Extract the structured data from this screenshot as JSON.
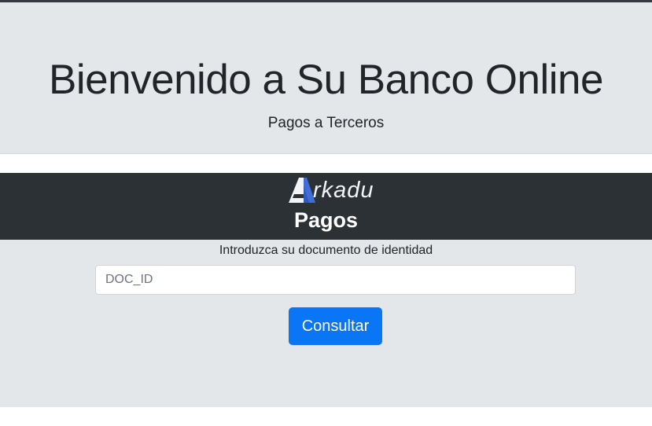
{
  "header": {
    "title": "Bienvenido a Su Banco Online",
    "subtitle": "Pagos a Terceros"
  },
  "brand": {
    "logo_text": "rkadu",
    "logo_letter": "A",
    "section_title": "Pagos"
  },
  "form": {
    "label": "Introduzca su documento de identidad",
    "input_value": "",
    "input_placeholder": "DOC_ID",
    "submit_label": "Consultar"
  },
  "colors": {
    "jumbotron_bg": "#e4e7ea",
    "dark_band": "#2c3136",
    "primary_button": "#0a75f5",
    "logo_accent": "#3f6fd6"
  }
}
